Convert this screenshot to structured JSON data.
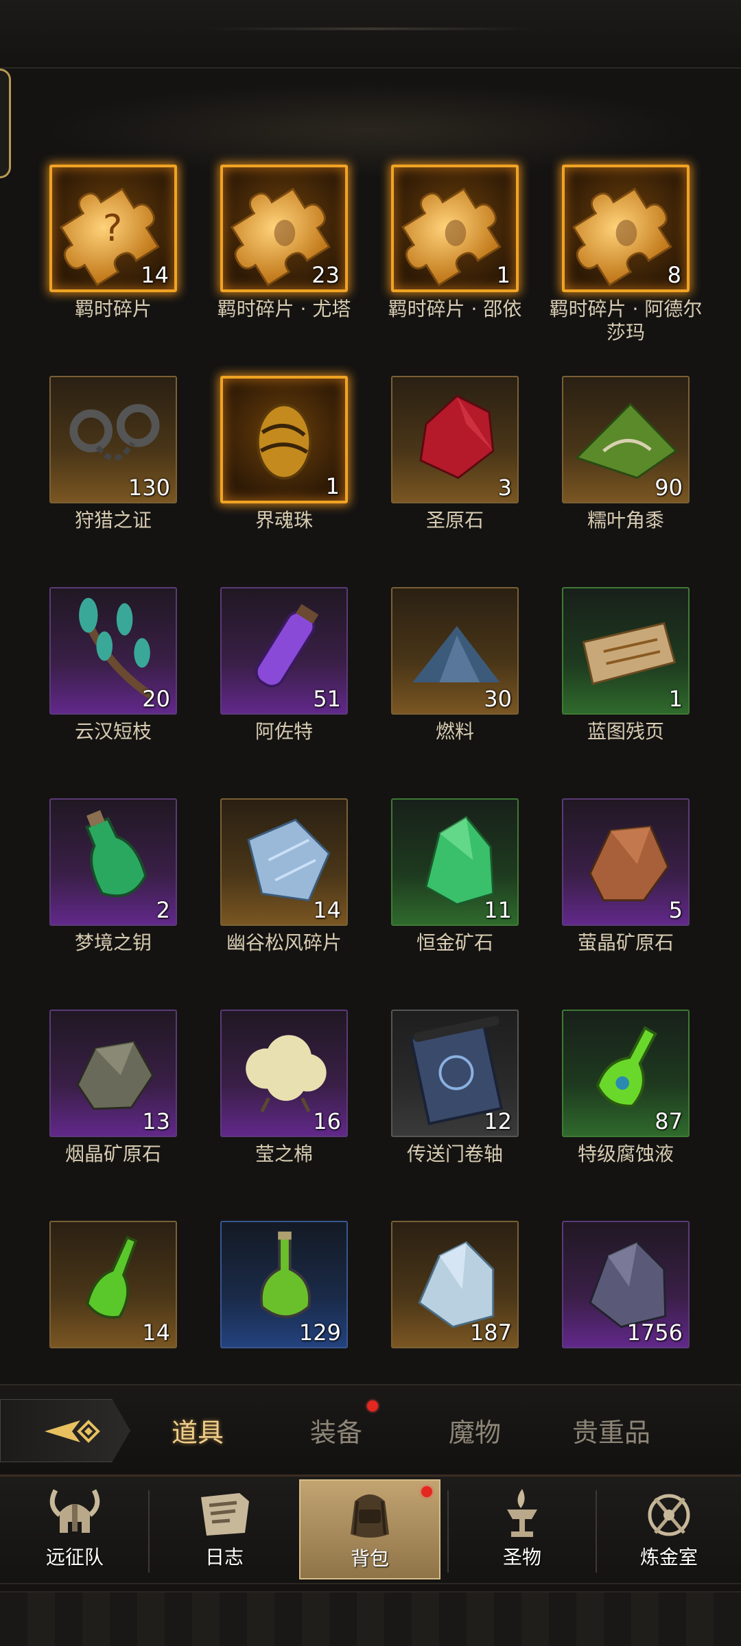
{
  "tabs": {
    "back_icon": "diamond-arrow-icon",
    "items": [
      {
        "label": "道具",
        "active": true,
        "badge": false
      },
      {
        "label": "装备",
        "active": false,
        "badge": true
      },
      {
        "label": "魔物",
        "active": false,
        "badge": false
      },
      {
        "label": "贵重品",
        "active": false,
        "badge": false
      }
    ]
  },
  "nav": {
    "items": [
      {
        "label": "远征队",
        "icon": "horned-helmet-icon",
        "active": false
      },
      {
        "label": "日志",
        "icon": "scroll-book-icon",
        "active": false
      },
      {
        "label": "背包",
        "icon": "backpack-icon",
        "active": true,
        "badge": true
      },
      {
        "label": "圣物",
        "icon": "brazier-icon",
        "active": false
      },
      {
        "label": "炼金室",
        "icon": "alchemy-circle-icon",
        "active": false
      }
    ]
  },
  "items": [
    {
      "name": "羁时碎片",
      "count": "14",
      "quality": "gold",
      "icon": "puzzle-piece-question-icon"
    },
    {
      "name": "羁时碎片 · 尤塔",
      "count": "23",
      "quality": "gold",
      "icon": "puzzle-piece-icon"
    },
    {
      "name": "羁时碎片 · 邵依",
      "count": "1",
      "quality": "gold",
      "icon": "puzzle-piece-icon"
    },
    {
      "name": "羁时碎片 · 阿德尔莎玛",
      "count": "8",
      "quality": "gold",
      "icon": "puzzle-piece-icon"
    },
    {
      "name": "狩猎之证",
      "count": "130",
      "quality": "orange",
      "icon": "shackles-icon"
    },
    {
      "name": "界魂珠",
      "count": "1",
      "quality": "gold",
      "icon": "soul-egg-icon"
    },
    {
      "name": "圣原石",
      "count": "3",
      "quality": "orange",
      "icon": "red-crystal-icon"
    },
    {
      "name": "糯叶角黍",
      "count": "90",
      "quality": "orange",
      "icon": "rice-dumpling-icon"
    },
    {
      "name": "云汉短枝",
      "count": "20",
      "quality": "purple",
      "icon": "branch-icon"
    },
    {
      "name": "阿佐特",
      "count": "51",
      "quality": "purple",
      "icon": "purple-vial-icon"
    },
    {
      "name": "燃料",
      "count": "30",
      "quality": "orange",
      "icon": "powder-pile-icon"
    },
    {
      "name": "蓝图残页",
      "count": "1",
      "quality": "green",
      "icon": "parchment-icon"
    },
    {
      "name": "梦境之钥",
      "count": "2",
      "quality": "purple",
      "icon": "green-lantern-bottle-icon"
    },
    {
      "name": "幽谷松风碎片",
      "count": "14",
      "quality": "orange",
      "icon": "blue-shard-icon"
    },
    {
      "name": "恒金矿石",
      "count": "11",
      "quality": "green",
      "icon": "green-ore-icon"
    },
    {
      "name": "萤晶矿原石",
      "count": "5",
      "quality": "purple",
      "icon": "amber-ore-icon"
    },
    {
      "name": "烟晶矿原石",
      "count": "13",
      "quality": "purple",
      "icon": "smoky-ore-icon"
    },
    {
      "name": "莹之棉",
      "count": "16",
      "quality": "purple",
      "icon": "cotton-icon"
    },
    {
      "name": "传送门卷轴",
      "count": "12",
      "quality": "gray",
      "icon": "scroll-icon"
    },
    {
      "name": "特级腐蚀液",
      "count": "87",
      "quality": "green",
      "icon": "acid-flask-icon"
    },
    {
      "name": "",
      "count": "14",
      "quality": "orange",
      "icon": "green-potion-icon"
    },
    {
      "name": "",
      "count": "129",
      "quality": "blue",
      "icon": "green-round-flask-icon"
    },
    {
      "name": "",
      "count": "187",
      "quality": "orange",
      "icon": "ice-ore-icon"
    },
    {
      "name": "",
      "count": "1756",
      "quality": "purple",
      "icon": "dark-ore-icon"
    }
  ]
}
